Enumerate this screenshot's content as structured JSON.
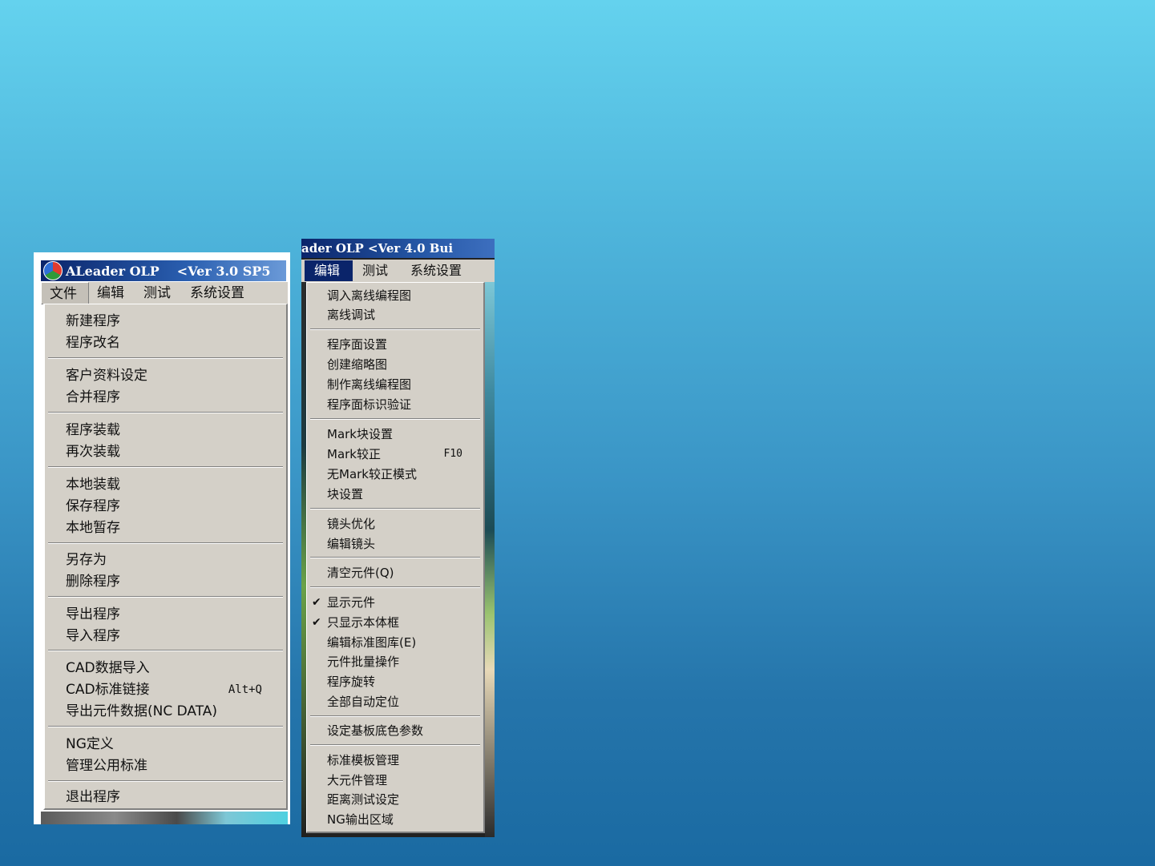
{
  "shot1": {
    "title_app": "ALeader OLP",
    "title_version": "<Ver 3.0 SP5",
    "menubar": [
      "文件",
      "编辑",
      "测试",
      "系统设置"
    ],
    "menu_items": {
      "new_program": "新建程序",
      "rename_program": "程序改名",
      "customer_info": "客户资料设定",
      "merge_program": "合并程序",
      "load_program": "程序装载",
      "reload": "再次装载",
      "local_load": "本地装载",
      "save_program": "保存程序",
      "local_temp_save": "本地暂存",
      "save_as": "另存为",
      "delete_program": "删除程序",
      "export_program": "导出程序",
      "import_program": "导入程序",
      "cad_import": "CAD数据导入",
      "cad_link": "CAD标准链接",
      "cad_link_shortcut": "Alt+Q",
      "export_component_data": "导出元件数据(NC DATA)",
      "ng_define": "NG定义",
      "manage_standards": "管理公用标准",
      "exit_program": "退出程序"
    }
  },
  "shot2": {
    "title": "ader OLP  <Ver 4.0 Bui",
    "menubar": [
      "编辑",
      "测试",
      "系统设置"
    ],
    "menu_items": {
      "load_offline_map": "调入离线编程图",
      "offline_debug": "离线调试",
      "board_face_settings": "程序面设置",
      "create_thumbnail": "创建缩略图",
      "make_offline_map": "制作离线编程图",
      "board_face_verify": "程序面标识验证",
      "mark_block_settings": "Mark块设置",
      "mark_calibrate": "Mark较正",
      "mark_calibrate_shortcut": "F10",
      "no_mark_mode": "无Mark较正模式",
      "block_settings": "块设置",
      "lens_optimize": "镜头优化",
      "edit_lens": "编辑镜头",
      "clear_components": "清空元件(Q)",
      "show_components": "显示元件",
      "show_body_frame_only": "只显示本体框",
      "edit_standard_library": "编辑标准图库(E)",
      "batch_component_ops": "元件批量操作",
      "program_rotate": "程序旋转",
      "auto_locate_all": "全部自动定位",
      "substrate_color_params": "设定基板底色参数",
      "template_management": "标准模板管理",
      "large_component_management": "大元件管理",
      "distance_test_settings": "距离测试设定",
      "ng_output_area": "NG输出区域"
    },
    "checked_items": [
      "显示元件",
      "只显示本体框"
    ],
    "check_mark": "✔"
  }
}
